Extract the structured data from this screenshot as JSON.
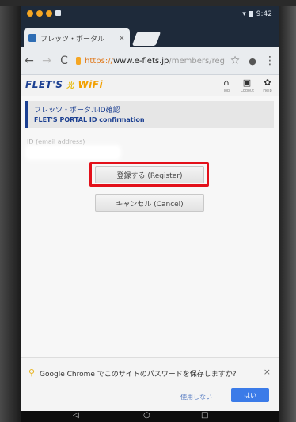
{
  "status_bar": {
    "time": "9:42"
  },
  "browser": {
    "tab_title": "フレッツ・ポータル",
    "tab_close": "×",
    "url_scheme": "https://",
    "url_host": "www.e-flets.jp",
    "url_path": "/members/reg",
    "back": "←",
    "forward": "→",
    "reload": "C",
    "star": "☆",
    "mic": "🎤",
    "menu": "⋮"
  },
  "site_header": {
    "logo_left": "FLET'S",
    "logo_mid": "光",
    "logo_right": "WiFi",
    "icon_top": "Top",
    "icon_login": "Logout",
    "icon_help": "Help"
  },
  "page": {
    "title_jp": "フレッツ・ポータルID確認",
    "title_en": "FLET'S PORTAL ID confirmation",
    "id_label": "ID (email address)",
    "register_button": "登録する (Register)",
    "cancel_button": "キャンセル (Cancel)"
  },
  "password_prompt": {
    "message": "Google Chrome でこのサイトのパスワードを保存しますか?",
    "close": "×",
    "never_button": "使用しない",
    "yes_button": "はい"
  },
  "nav": {
    "back": "◁",
    "home": "○",
    "recent": "□"
  }
}
